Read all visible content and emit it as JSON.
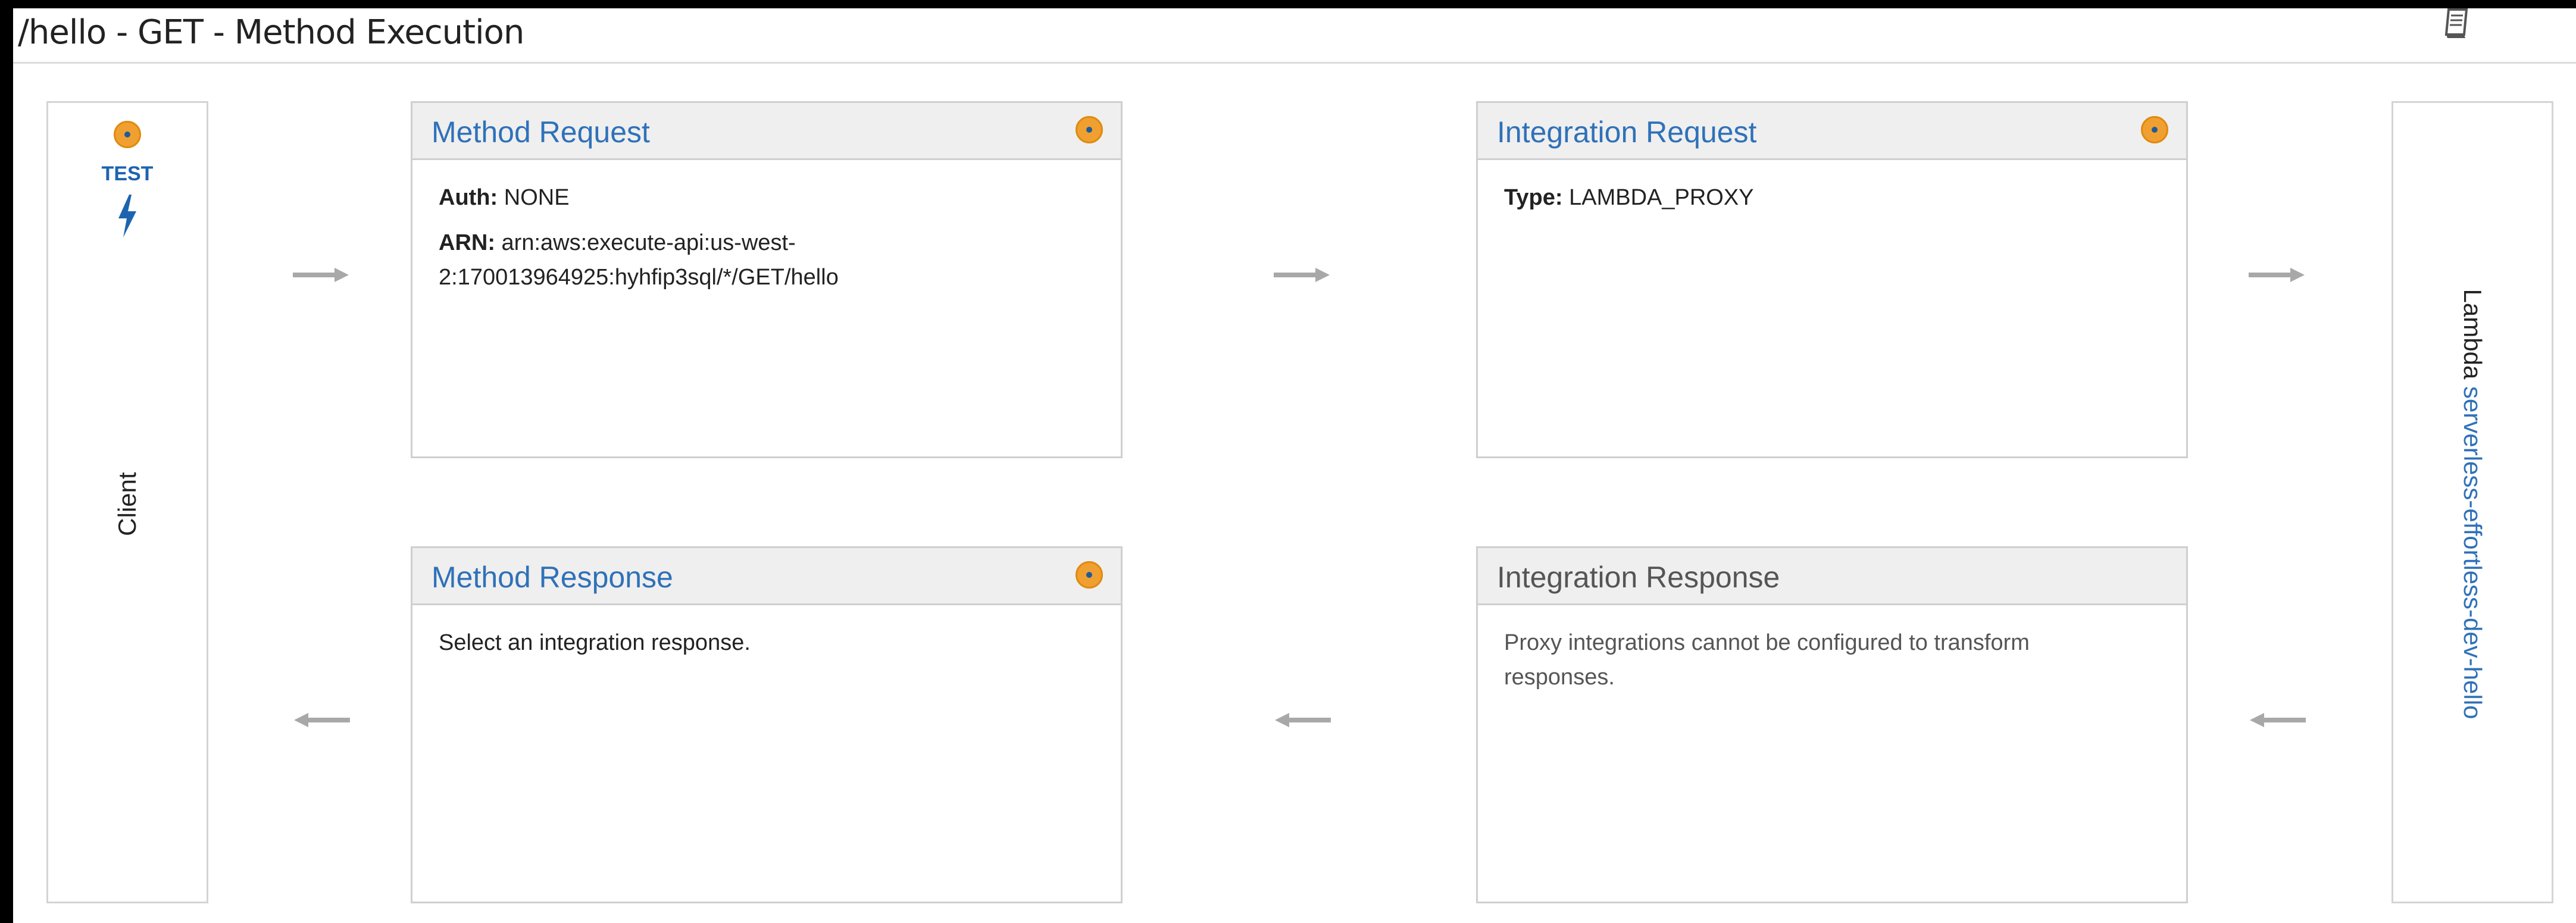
{
  "page": {
    "title": "/hello - GET - Method Execution",
    "doc_icon": "document-icon"
  },
  "client": {
    "test_label": "TEST",
    "test_icon": "lightning-bolt-icon",
    "label": "Client"
  },
  "lambda": {
    "prefix": "Lambda",
    "function_name": "serverless-effortless-dev-hello"
  },
  "method_request": {
    "title": "Method Request",
    "auth_label": "Auth:",
    "auth_value": "NONE",
    "arn_label": "ARN:",
    "arn_value_line1": "arn:aws:execute-api:us-west-",
    "arn_value_line2": "2:170013964925:hyhfip3sql/*/GET/hello"
  },
  "integration_request": {
    "title": "Integration Request",
    "type_label": "Type:",
    "type_value": "LAMBDA_PROXY"
  },
  "method_response": {
    "title": "Method Response",
    "body": "Select an integration response."
  },
  "integration_response": {
    "title": "Integration Response",
    "body_line1": "Proxy integrations cannot be configured to transform",
    "body_line2": "responses."
  },
  "colors": {
    "link_blue": "#2f71b8",
    "status_orange": "#f0a030",
    "arrow_gray": "#a8a8a8"
  }
}
